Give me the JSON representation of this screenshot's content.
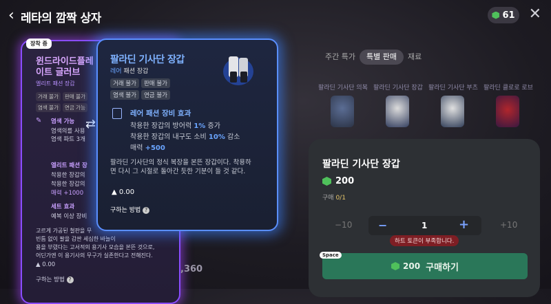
{
  "header": {
    "title": "레타의 깜짝 상자",
    "currency": "61"
  },
  "tabs": [
    "주간 특가",
    "특별 판매",
    "재료"
  ],
  "shop_items": [
    {
      "name": "팔라딘 기사단 의복"
    },
    {
      "name": "팔라딘 기사단 장갑"
    },
    {
      "name": "팔라딘 기사단 부츠"
    },
    {
      "name": "팔라딘 클로로 로브"
    }
  ],
  "equipped": {
    "badge": "장착 중",
    "name": "윈드라이드플레이트 글러브",
    "grade": "엘리트 패션 장갑",
    "tags": [
      "거래 불가",
      "판매 불가",
      "염색 불가",
      "연금 가능"
    ],
    "dye_title": "염색 가능",
    "dye_line1": "염색의를 사용",
    "dye_line2": "염색 파트 3개",
    "effect_title": "엘리트 패션 장",
    "effect_line1": "착용한 장갑의",
    "effect_line2": "착용한 장갑의",
    "effect_line3": "매력 +1000",
    "set_title": "세트 효과",
    "set_line": "예복 이상 장비",
    "desc1": "고르게 가공된 철판을 무",
    "desc2": "빈틈 없이 팔을 감싼 세심한 바늘이",
    "desc3": "용을 부렸다는 고서적의 용기사 모습을 본뜬 것으로,",
    "desc4": "어딘가엔 이 용기사의 무구가 실존한다고 전해진다.",
    "weight": "0.00",
    "howto": "구하는 방법"
  },
  "tooltip": {
    "name": "팔라딘 기사단 장갑",
    "grade_prefix": "레어",
    "grade_suffix": "패션 장갑",
    "tags": [
      "거래 불가",
      "판매 불가",
      "염색 불가",
      "연금 불가"
    ],
    "effect_title": "레어 패션 장비 효과",
    "effect_line1_a": "착용한 장갑의 방어력 ",
    "effect_line1_b": "1%",
    "effect_line1_c": " 증가",
    "effect_line2_a": "착용한 장갑의 내구도 소비 ",
    "effect_line2_b": "10%",
    "effect_line2_c": " 감소",
    "effect_line3_a": "매력 ",
    "effect_line3_b": "+500",
    "desc": "팔라딘 기사단의 정식 복장을 본뜬 장갑이다. 착용하면 다시 그 시절로 돌아간 듯한 기분이 들 것 같다.",
    "weight": "0.00",
    "howto": "구하는 방법"
  },
  "purchase": {
    "name": "팔라딘 기사단 장갑",
    "price": "200",
    "buy_count_label": "구매",
    "buy_count": "0/1",
    "minus10": "−10",
    "plus10": "+10",
    "qty": "1",
    "warning": "하트 토큰이 부족합니다.",
    "space": "Space",
    "buy_price": "200",
    "buy_label": "구매하기"
  },
  "background_number": ",360",
  "colors": {
    "accent_blue": "#5a8fff",
    "elite_purple": "#8a4cff",
    "buy_green": "#2a7759",
    "gem_green": "#4fc05b"
  }
}
